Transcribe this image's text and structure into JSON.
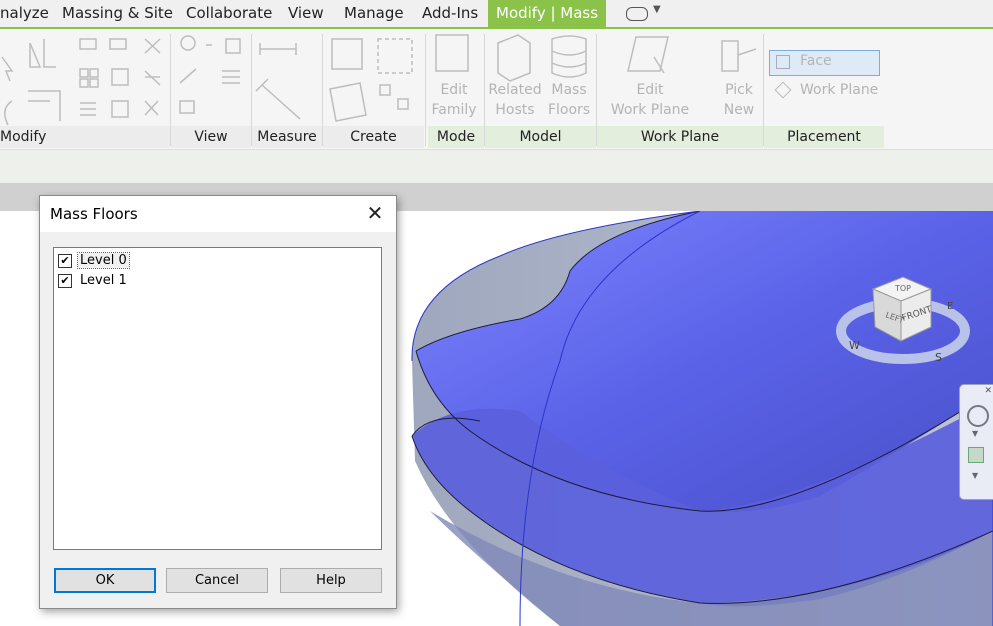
{
  "menu": {
    "tabs": [
      "nalyze",
      "Massing & Site",
      "Collaborate",
      "View",
      "Manage",
      "Add-Ins",
      "Modify | Mass"
    ]
  },
  "ribbon": {
    "panels": [
      "Modify",
      "View",
      "Measure",
      "Create",
      "Mode",
      "Model",
      "Work Plane",
      "Placement"
    ],
    "mode": {
      "edit_family": [
        "Edit",
        "Family"
      ]
    },
    "model": {
      "related_hosts": [
        "Related",
        "Hosts"
      ],
      "mass_floors": [
        "Mass",
        "Floors"
      ]
    },
    "work_plane": {
      "edit_work_plane": [
        "Edit",
        "Work Plane"
      ],
      "pick_new": [
        "Pick",
        "New"
      ]
    },
    "placement": {
      "face": "Face",
      "work_plane": "Work Plane"
    }
  },
  "dialog": {
    "title": "Mass Floors",
    "levels": [
      {
        "label": "Level 0",
        "checked": true
      },
      {
        "label": "Level 1",
        "checked": true
      }
    ],
    "buttons": {
      "ok": "OK",
      "cancel": "Cancel",
      "help": "Help"
    }
  },
  "viewcube": {
    "top": "TOP",
    "left": "LEFT",
    "front": "FRONT",
    "west": "W",
    "south": "S",
    "east": "E"
  },
  "colors": {
    "accent": "#8bc34a",
    "mass": "#5a62e8",
    "dialog_focus": "#0078d7"
  }
}
